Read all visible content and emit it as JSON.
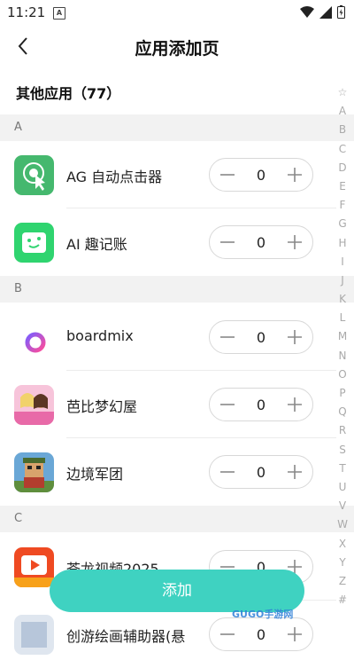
{
  "status_bar": {
    "time": "11:21",
    "notif_letter": "A"
  },
  "header": {
    "title": "应用添加页"
  },
  "section_title": "其他应用（77）",
  "groups": [
    {
      "letter": "A"
    },
    {
      "letter": "B"
    },
    {
      "letter": "C"
    }
  ],
  "apps": [
    {
      "name": "AG 自动点击器",
      "count": "0"
    },
    {
      "name": "AI 趣记账",
      "count": "0"
    },
    {
      "name": "boardmix",
      "count": "0"
    },
    {
      "name": "芭比梦幻屋",
      "count": "0"
    },
    {
      "name": "边境军团",
      "count": "0"
    },
    {
      "name": "苍龙视频2025",
      "count": "0"
    },
    {
      "name": "创游绘画辅助器(悬",
      "count": "0"
    }
  ],
  "index_bar": [
    "☆",
    "A",
    "B",
    "C",
    "D",
    "E",
    "F",
    "G",
    "H",
    "I",
    "J",
    "K",
    "L",
    "M",
    "N",
    "O",
    "P",
    "Q",
    "R",
    "S",
    "T",
    "U",
    "V",
    "W",
    "X",
    "Y",
    "Z",
    "#"
  ],
  "add_button": {
    "label": "添加"
  },
  "watermark": "GUGO手游网",
  "colors": {
    "accent": "#3fd2c1",
    "group_bg": "#f2f2f2"
  }
}
